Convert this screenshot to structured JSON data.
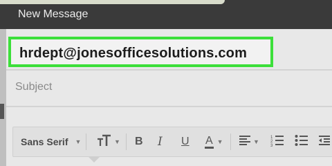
{
  "window": {
    "title": "New Message"
  },
  "compose": {
    "to_value": "hrdept@jonesofficesolutions.com",
    "subject_placeholder": "Subject"
  },
  "toolbar": {
    "font_family": "Sans Serif",
    "icons": [
      "text-size-icon",
      "bold-icon",
      "italic-icon",
      "underline-icon",
      "text-color-icon",
      "align-icon",
      "numbered-list-icon",
      "bulleted-list-icon",
      "indent-less-icon"
    ]
  },
  "colors": {
    "highlight": "#3cdf3a",
    "title_bar": "#3a3a3a"
  }
}
